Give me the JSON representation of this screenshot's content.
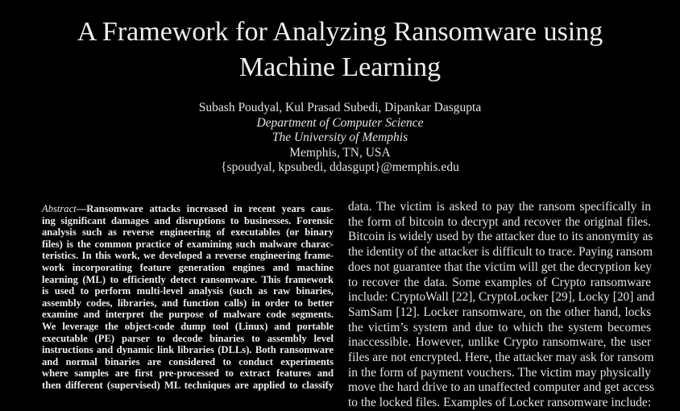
{
  "paper": {
    "title_line1": "A Framework for Analyzing Ransomware using",
    "title_line2": "Machine Learning",
    "authors": "Subash Poudyal, Kul Prasad Subedi, Dipankar Dasgupta",
    "department": "Department of Computer Science",
    "university": "The University of Memphis",
    "location": "Memphis, TN, USA",
    "emails": "{spoudyal, kpsubedi, ddasgupt}@memphis.edu"
  },
  "abstract": {
    "label": "Abstract",
    "lines": [
      "—Ransomware attacks increased in recent years caus-",
      "ing significant damages and disruptions to businesses. Forensic",
      "analysis such as reverse engineering of executables (or binary",
      "files) is the common practice of examining such malware charac-",
      "teristics. In this work, we developed a reverse engineering frame-",
      "work incorporating feature generation engines and machine",
      "learning (ML) to efficiently detect ransomware. This framework",
      "is used to perform multi-level analysis (such as raw binaries,",
      "assembly codes, libraries, and function calls) in order to better",
      "examine and interpret the purpose of malware code segments.",
      "We leverage the object-code dump tool (Linux) and portable",
      "executable (PE) parser to decode binaries to assembly level",
      "instructions and dynamic link libraries (DLLs). Both ransomware",
      "and normal binaries are considered to conduct experiments",
      "where samples are first pre-processed to extract features and",
      "then different (supervised) ML techniques are applied to classify"
    ]
  },
  "body_right": {
    "lines": [
      "data. The victim is asked to pay the ransom specifically in",
      "the form of bitcoin to decrypt and recover the original files.",
      "Bitcoin is widely used by the attacker due to its anonymity as",
      "the identity of the attacker is difficult to trace. Paying ransom",
      "does not guarantee that the victim will get the decryption key",
      "to recover the data. Some examples of Crypto ransomware",
      "include: CryptoWall [22], CryptoLocker [29], Locky [20] and",
      "SamSam [12]. Locker ransomware, on the other hand, locks",
      "the victim’s system and due to which the system becomes",
      "inaccessible. However, unlike Crypto ransomware, the user",
      "files are not encrypted. Here, the attacker may ask for ransom",
      "in the form of payment vouchers. The victim may physically",
      "move the hard drive to an unaffected computer and get access",
      "to the locked files. Examples of Locker ransomware include:"
    ]
  }
}
